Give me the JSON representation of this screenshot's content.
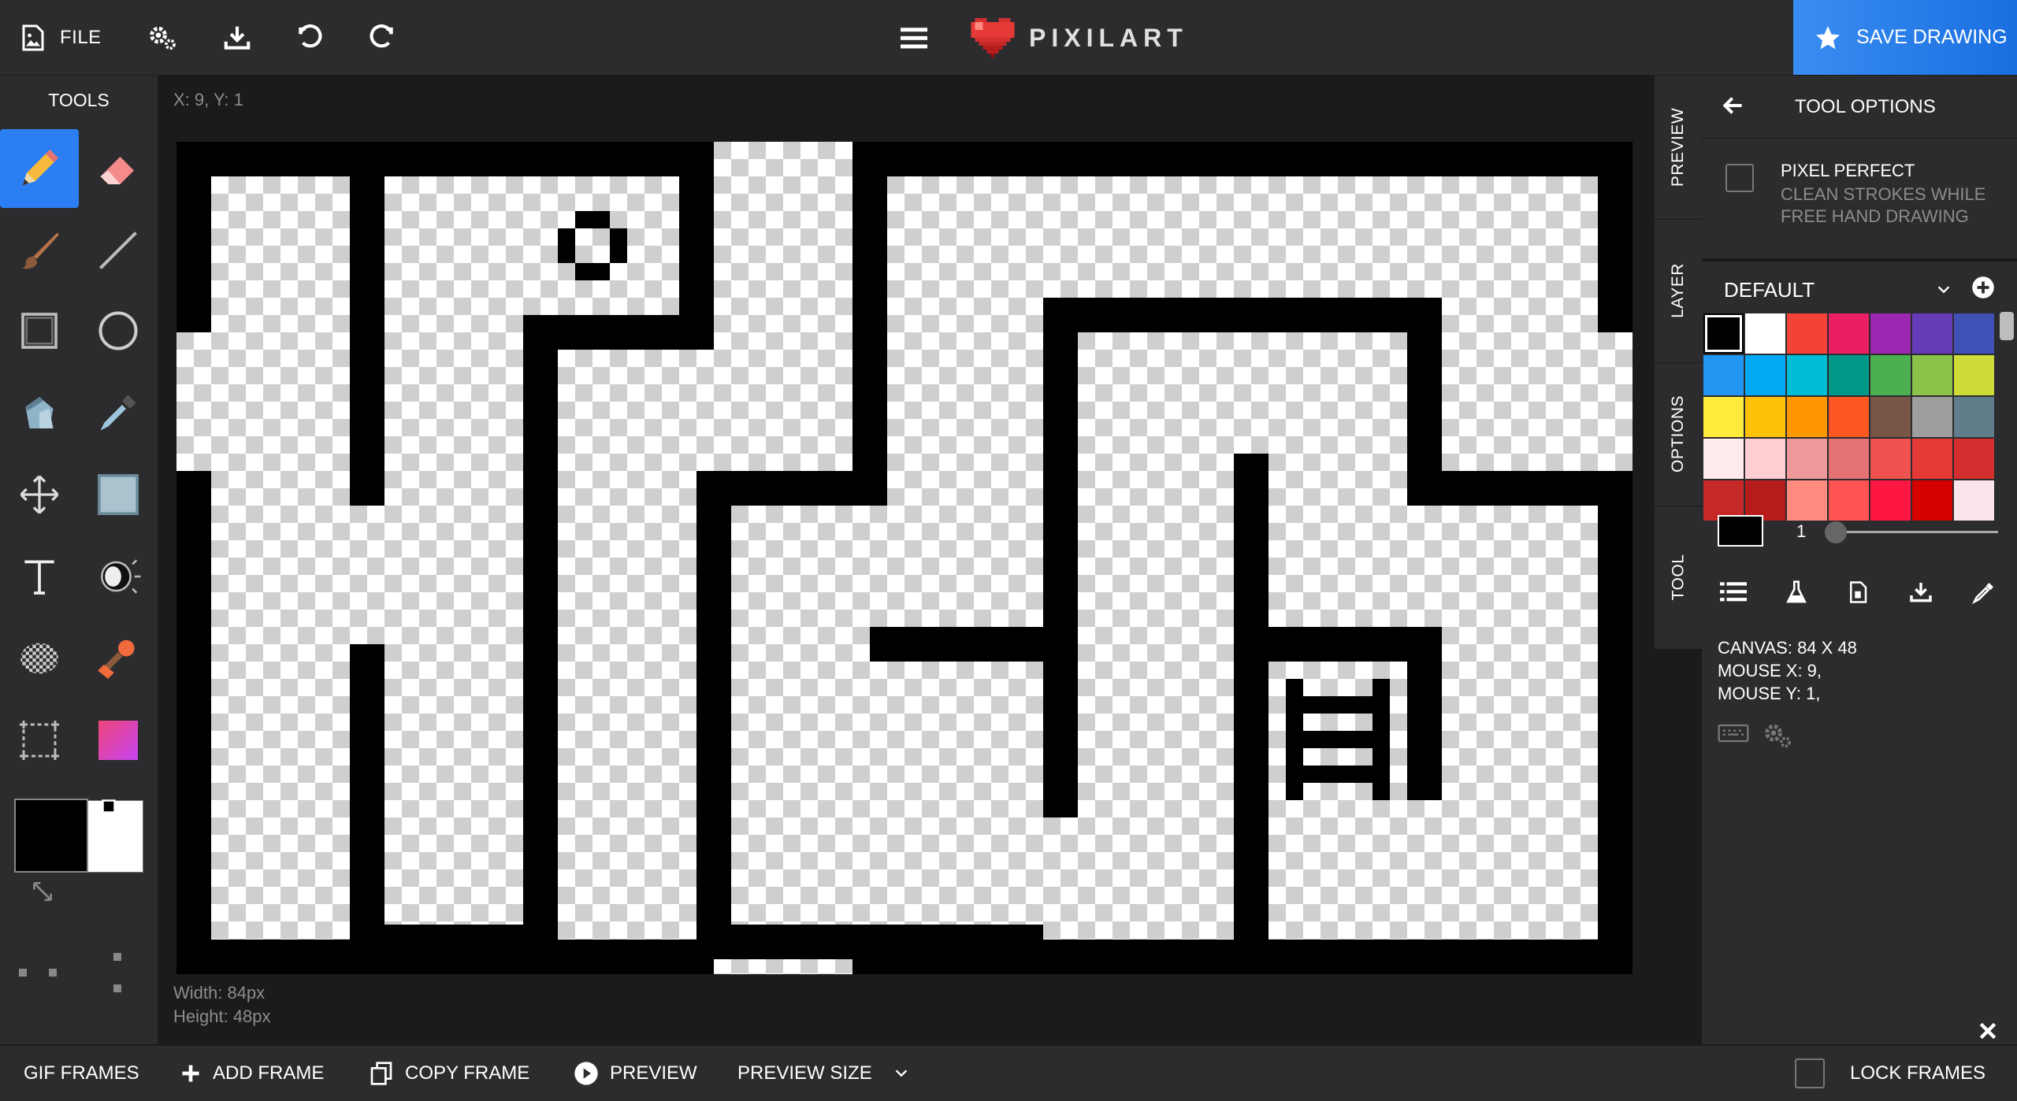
{
  "topbar": {
    "file_label": "FILE",
    "brand": "PIXILART",
    "save_label": "SAVE DRAWING"
  },
  "tools": {
    "title": "TOOLS",
    "items": [
      "pencil",
      "eraser",
      "brush",
      "line",
      "rectangle",
      "circle",
      "fill-bucket",
      "eyedropper",
      "move",
      "select",
      "text",
      "lighten",
      "dither",
      "stamp",
      "crop",
      "gradient"
    ],
    "primary_color": "#000000",
    "secondary_color": "#ffffff"
  },
  "canvas_area": {
    "coords": "X: 9, Y: 1",
    "width_text": "Width: 84px",
    "height_text": "Height: 48px"
  },
  "side_tabs": [
    "PREVIEW",
    "LAYER",
    "OPTIONS",
    "TOOL"
  ],
  "tool_options": {
    "title": "TOOL OPTIONS",
    "pixel_perfect_label": "PIXEL PERFECT",
    "pixel_perfect_desc_1": "CLEAN STROKES WHILE",
    "pixel_perfect_desc_2": "FREE HAND DRAWING",
    "pixel_perfect_checked": false
  },
  "palette": {
    "name": "DEFAULT",
    "colors": [
      "#000000",
      "#ffffff",
      "#f44336",
      "#e91e63",
      "#9c27b0",
      "#673ab7",
      "#3f51b5",
      "#2196f3",
      "#03a9f4",
      "#00bcd4",
      "#009688",
      "#4caf50",
      "#8bc34a",
      "#cddc39",
      "#ffeb3b",
      "#ffc107",
      "#ff9800",
      "#ff5722",
      "#795548",
      "#9e9e9e",
      "#607d8b",
      "#ffebee",
      "#ffcdd2",
      "#ef9a9a",
      "#e57373",
      "#ef5350",
      "#e53935",
      "#d32f2f",
      "#c62828",
      "#b71c1c",
      "#ff8a80",
      "#ff5252",
      "#ff1744",
      "#d50000",
      "#fce4ec"
    ],
    "brush_size": "1"
  },
  "info": {
    "canvas": "CANVAS: 84 X 48",
    "mouse_x": "MOUSE X: 9,",
    "mouse_y": "MOUSE Y: 1,"
  },
  "bottombar": {
    "gif_frames": "GIF FRAMES",
    "add_frame": "ADD FRAME",
    "copy_frame": "COPY FRAME",
    "preview": "PREVIEW",
    "preview_size": "PREVIEW SIZE",
    "lock_frames": "LOCK FRAMES",
    "lock_checked": false
  }
}
